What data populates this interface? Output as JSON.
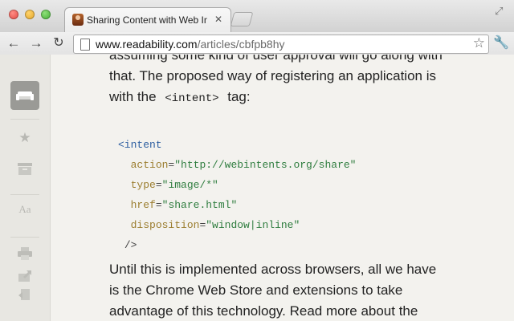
{
  "browser": {
    "tab": {
      "title": "Sharing Content with Web In"
    },
    "url": {
      "host": "www.readability.com",
      "path": "/articles/cbfpb8hy"
    }
  },
  "sidebar": {
    "items": [
      "readability-couch-icon",
      "star-icon",
      "archive-icon",
      "font-size-icon",
      "print-icon",
      "share-icon",
      "export-icon"
    ]
  },
  "article": {
    "para1_line1": "assuming some kind of user approval will go along with",
    "para1_line2": "that. The proposed way of registering an application is",
    "para1_line3_pre": "with the ",
    "para1_code": "<intent>",
    "para1_line3_post": " tag:",
    "code": {
      "open": "<intent",
      "action_attr": "action",
      "action_val": "\"http://webintents.org/share\"",
      "type_attr": "type",
      "type_val": "\"image/*\"",
      "href_attr": "href",
      "href_val": "\"share.html\"",
      "disp_attr": "disposition",
      "disp_val": "\"window|inline\"",
      "close": "/>"
    },
    "para2_line1": "Until this is implemented across browsers, all we have",
    "para2_line2": "is the Chrome Web Store and extensions to take",
    "para2_line3": "advantage of this technology. Read more about the"
  }
}
